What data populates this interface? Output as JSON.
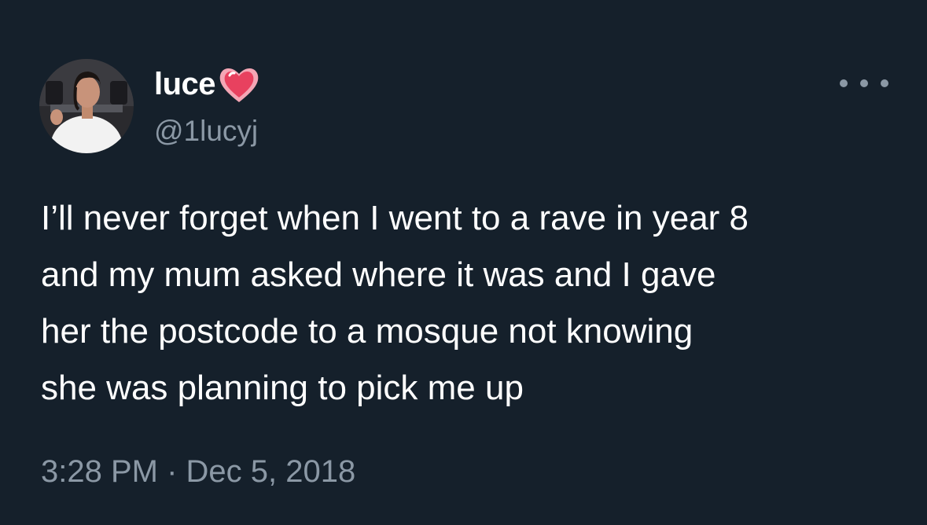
{
  "user": {
    "display_name": "luce",
    "name_emoji": "heart-icon",
    "handle": "@1lucyj",
    "avatar": "avatar"
  },
  "tweet": {
    "text_lines": [
      "I’ll never forget when I went to a rave in year 8",
      "and my mum asked where it was and I gave",
      "her the postcode to a mosque not knowing",
      "she was planning to pick me up"
    ],
    "timestamp": "3:28 PM · Dec 5, 2018"
  },
  "menu": {
    "icon": "more-icon"
  },
  "colors": {
    "background": "#15202b",
    "primary_text": "#ffffff",
    "secondary_text": "#8b98a5",
    "heart": "#f0506e"
  }
}
